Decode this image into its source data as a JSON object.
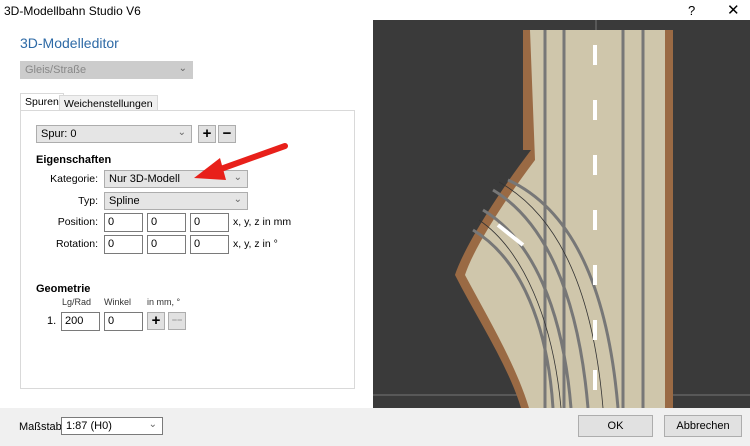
{
  "window": {
    "title": "3D-Modellbahn Studio V6",
    "help": "?",
    "close": "✕"
  },
  "editor": {
    "heading": "3D-Modelleditor",
    "type_select": "Gleis/Straße"
  },
  "tabs": [
    {
      "label": "Spuren",
      "active": true
    },
    {
      "label": "Weichenstellungen",
      "active": false
    }
  ],
  "spur": {
    "select": "Spur: 0",
    "add": "+",
    "remove": "−"
  },
  "eigenschaften": {
    "heading": "Eigenschaften",
    "kategorie_label": "Kategorie:",
    "kategorie": "Nur 3D-Modell",
    "typ_label": "Typ:",
    "typ": "Spline",
    "position_label": "Position:",
    "position": [
      "0",
      "0",
      "0"
    ],
    "position_unit": "x, y, z in mm",
    "rotation_label": "Rotation:",
    "rotation": [
      "0",
      "0",
      "0"
    ],
    "rotation_unit": "x, y, z in °"
  },
  "geometrie": {
    "heading": "Geometrie",
    "col1": "Lg/Rad",
    "col2": "Winkel",
    "col3": "in mm, °",
    "rows": [
      {
        "index": "1.",
        "length": "200",
        "angle": "0"
      }
    ],
    "add": "+",
    "remove": "−−"
  },
  "footer": {
    "scale_label": "Maßstab:",
    "scale": "1:87 (H0)",
    "ok": "OK",
    "cancel": "Abbrechen"
  },
  "colors": {
    "accent": "#2e6aa6",
    "arrow": "#e8201a",
    "viewport_bg": "#3a3a3a",
    "ballast": "#cfc6ab",
    "edge": "#9a6a44"
  }
}
